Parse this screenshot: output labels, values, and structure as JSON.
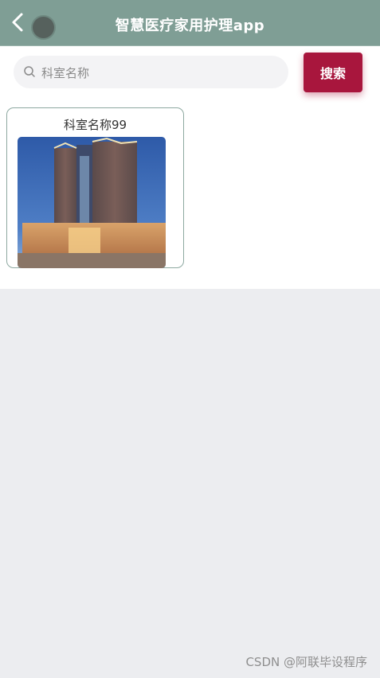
{
  "header": {
    "title": "智慧医疗家用护理app",
    "back_icon": "chevron-left-icon",
    "background_color": "#7f9e95"
  },
  "search": {
    "placeholder": "科室名称",
    "value": "",
    "button_label": "搜索",
    "button_color": "#a8163d",
    "icon": "search-icon"
  },
  "departments": [
    {
      "name": "科室名称99",
      "image": "hospital-building-photo"
    }
  ],
  "watermark": "CSDN @阿联毕设程序"
}
